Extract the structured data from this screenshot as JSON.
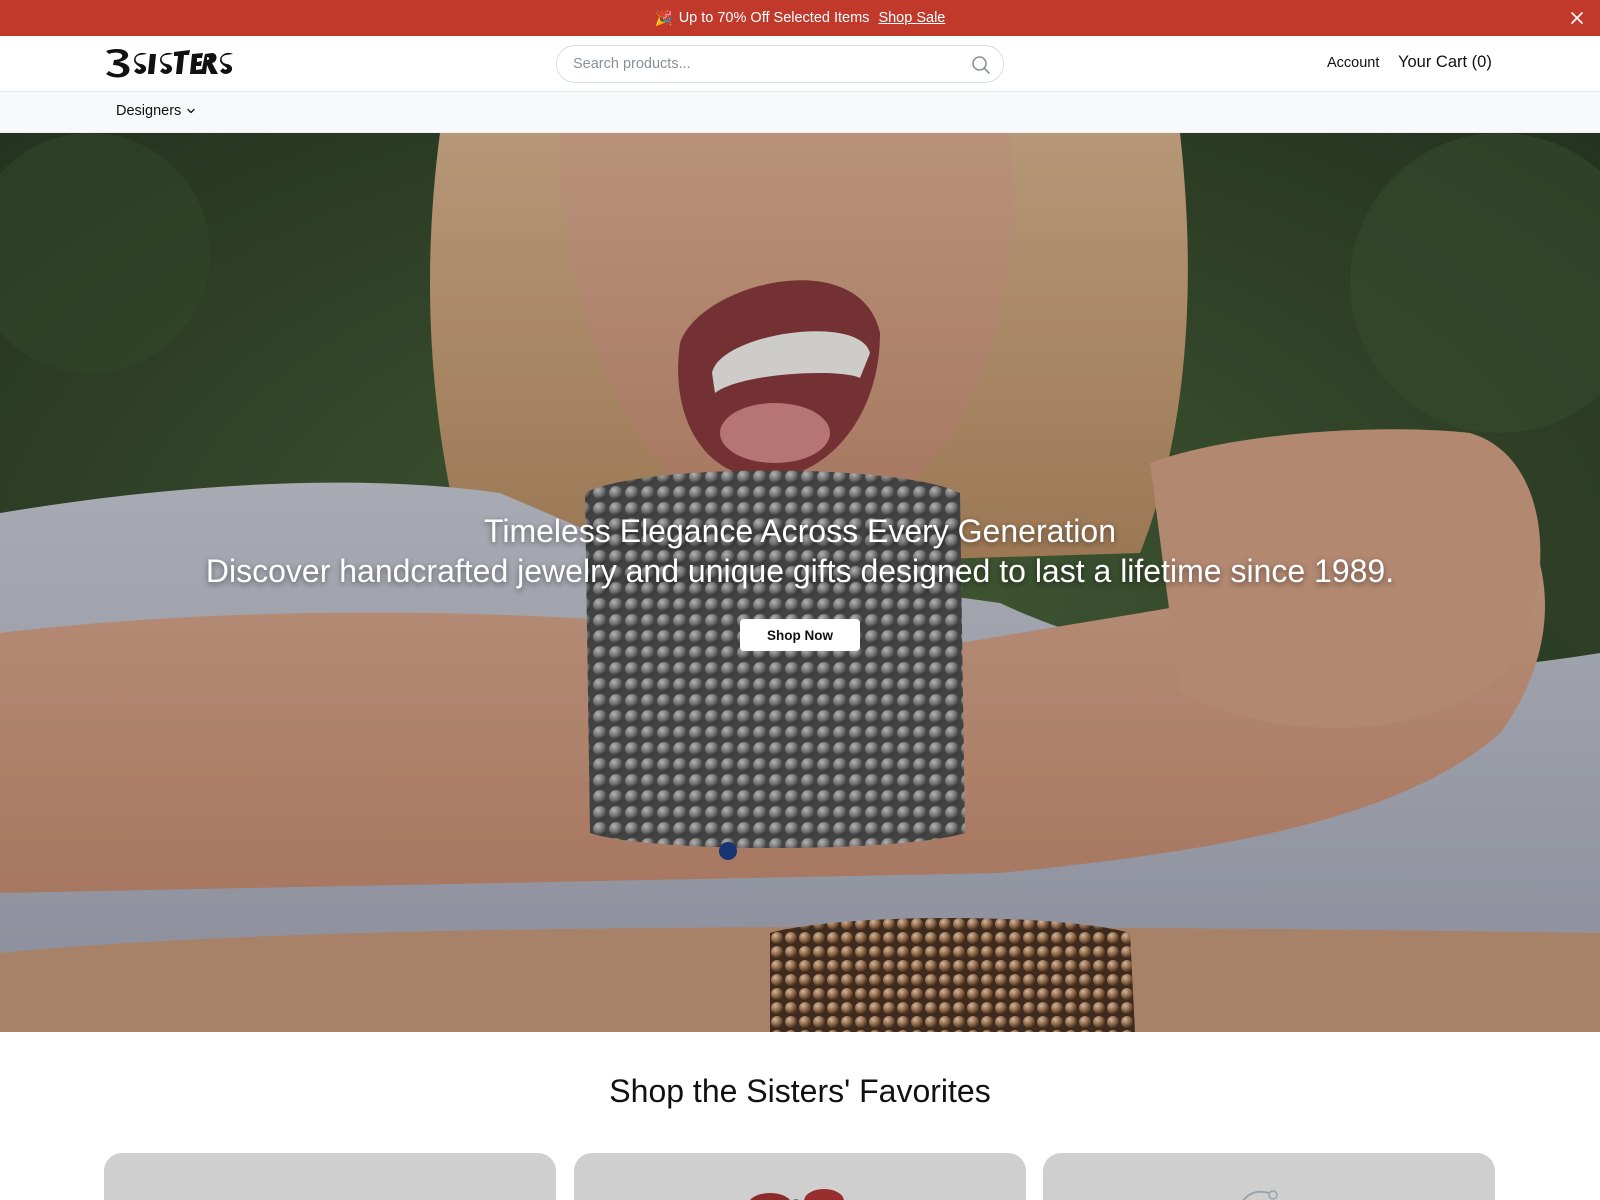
{
  "promo": {
    "emoji": "🎉",
    "text": "Up to 70% Off Selected Items",
    "link": "Shop Sale",
    "close_icon": "close-icon",
    "bg_color": "#c0392b"
  },
  "header": {
    "logo_text": "3 SISTERS",
    "search_placeholder": "Search products...",
    "search_icon": "search-icon",
    "account_label": "Account",
    "cart_label": "Your Cart (0)"
  },
  "nav": {
    "items": [
      {
        "label": "Designers",
        "icon": "chevron-down-icon"
      }
    ]
  },
  "hero": {
    "title": "Timeless Elegance Across Every Generation",
    "subtitle": "Discover handcrafted jewelry and unique gifts designed to last a lifetime since 1989.",
    "cta_label": "Shop Now"
  },
  "favorites": {
    "title": "Shop the Sisters' Favorites",
    "cards": [
      "product-card-1",
      "product-card-2",
      "product-card-3"
    ]
  }
}
